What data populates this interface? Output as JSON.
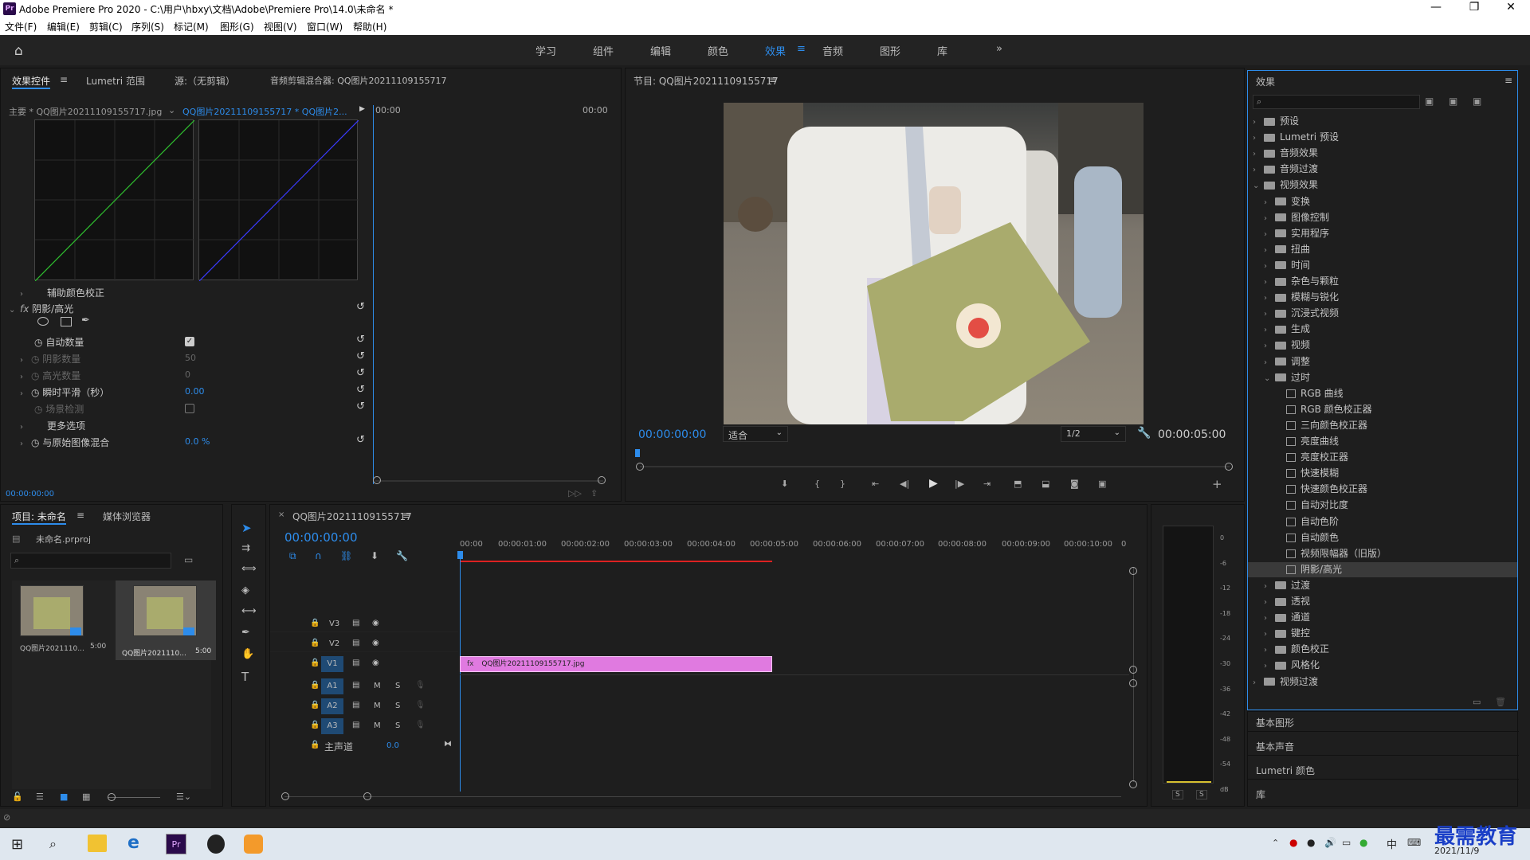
{
  "window": {
    "title": "Adobe Premiere Pro 2020 - C:\\用户\\hbxy\\文档\\Adobe\\Premiere Pro\\14.0\\未命名 *",
    "logo": "Pr"
  },
  "menu": [
    "文件(F)",
    "编辑(E)",
    "剪辑(C)",
    "序列(S)",
    "标记(M)",
    "图形(G)",
    "视图(V)",
    "窗口(W)",
    "帮助(H)"
  ],
  "workspaces": [
    "学习",
    "组件",
    "编辑",
    "颜色",
    "效果",
    "音频",
    "图形",
    "库"
  ],
  "workspace_active": "效果",
  "effect_controls": {
    "tabs": [
      "效果控件",
      "Lumetri 范围",
      "源:（无剪辑）",
      "音频剪辑混合器: QQ图片20211109155717"
    ],
    "master": "主要 * QQ图片20211109155717.jpg",
    "clip": "QQ图片20211109155717 * QQ图片2...",
    "time_start": "00:00",
    "time_end": "00:00",
    "sections": [
      {
        "label": "辅助颜色校正"
      },
      {
        "label": "阴影/高光"
      }
    ],
    "params": [
      {
        "label": "自动数量",
        "value": ""
      },
      {
        "label": "阴影数量",
        "value": "50"
      },
      {
        "label": "高光数量",
        "value": "0"
      },
      {
        "label": "瞬时平滑（秒）",
        "value": "0.00"
      },
      {
        "label": "场景检测",
        "value": ""
      },
      {
        "label": "更多选项",
        "value": ""
      },
      {
        "label": "与原始图像混合",
        "value": "0.0 %"
      }
    ],
    "timecode": "00:00:00:00"
  },
  "program": {
    "title": "节目: QQ图片20211109155717",
    "timecode": "00:00:00:00",
    "fit": "适合",
    "quality": "1/2",
    "duration": "00:00:05:00"
  },
  "project": {
    "tabs": [
      "项目: 未命名",
      "媒体浏览器"
    ],
    "file": "未命名.prproj",
    "items": [
      {
        "name": "QQ图片2021110...",
        "dur": "5:00"
      },
      {
        "name": "QQ图片2021110...",
        "dur": "5:00"
      }
    ]
  },
  "timeline": {
    "title": "QQ图片20211109155717",
    "timecode": "00:00:00:00",
    "ruler": [
      "00:00",
      "00:00:01:00",
      "00:00:02:00",
      "00:00:03:00",
      "00:00:04:00",
      "00:00:05:00",
      "00:00:06:00",
      "00:00:07:00",
      "00:00:08:00",
      "00:00:09:00",
      "00:00:10:00",
      "0"
    ],
    "video_tracks": [
      "V3",
      "V2",
      "V1"
    ],
    "audio_tracks": [
      "A1",
      "A2",
      "A3"
    ],
    "master": "主声道",
    "master_value": "0.0",
    "clip": "QQ图片20211109155717.jpg"
  },
  "meter": {
    "scale": [
      "0",
      "-6",
      "-12",
      "-18",
      "-24",
      "-30",
      "-36",
      "-42",
      "-48",
      "-54",
      "dB"
    ],
    "solo": [
      "S",
      "S"
    ]
  },
  "effects_panel": {
    "title": "效果",
    "tree": [
      {
        "label": "预设",
        "level": 0,
        "type": "folder"
      },
      {
        "label": "Lumetri 预设",
        "level": 0,
        "type": "folder"
      },
      {
        "label": "音频效果",
        "level": 0,
        "type": "folder"
      },
      {
        "label": "音频过渡",
        "level": 0,
        "type": "folder"
      },
      {
        "label": "视频效果",
        "level": 0,
        "type": "folder",
        "open": true
      },
      {
        "label": "变换",
        "level": 1,
        "type": "folder"
      },
      {
        "label": "图像控制",
        "level": 1,
        "type": "folder"
      },
      {
        "label": "实用程序",
        "level": 1,
        "type": "folder"
      },
      {
        "label": "扭曲",
        "level": 1,
        "type": "folder"
      },
      {
        "label": "时间",
        "level": 1,
        "type": "folder"
      },
      {
        "label": "杂色与颗粒",
        "level": 1,
        "type": "folder"
      },
      {
        "label": "模糊与锐化",
        "level": 1,
        "type": "folder"
      },
      {
        "label": "沉浸式视频",
        "level": 1,
        "type": "folder"
      },
      {
        "label": "生成",
        "level": 1,
        "type": "folder"
      },
      {
        "label": "视频",
        "level": 1,
        "type": "folder"
      },
      {
        "label": "调整",
        "level": 1,
        "type": "folder"
      },
      {
        "label": "过时",
        "level": 1,
        "type": "folder",
        "open": true
      },
      {
        "label": "RGB 曲线",
        "level": 2,
        "type": "fx"
      },
      {
        "label": "RGB 颜色校正器",
        "level": 2,
        "type": "fx"
      },
      {
        "label": "三向颜色校正器",
        "level": 2,
        "type": "fx"
      },
      {
        "label": "亮度曲线",
        "level": 2,
        "type": "fx"
      },
      {
        "label": "亮度校正器",
        "level": 2,
        "type": "fx"
      },
      {
        "label": "快速模糊",
        "level": 2,
        "type": "fx"
      },
      {
        "label": "快速颜色校正器",
        "level": 2,
        "type": "fx"
      },
      {
        "label": "自动对比度",
        "level": 2,
        "type": "fx"
      },
      {
        "label": "自动色阶",
        "level": 2,
        "type": "fx"
      },
      {
        "label": "自动颜色",
        "level": 2,
        "type": "fx"
      },
      {
        "label": "视频限幅器（旧版）",
        "level": 2,
        "type": "fx"
      },
      {
        "label": "阴影/高光",
        "level": 2,
        "type": "fx",
        "selected": true
      },
      {
        "label": "过渡",
        "level": 1,
        "type": "folder"
      },
      {
        "label": "透视",
        "level": 1,
        "type": "folder"
      },
      {
        "label": "通道",
        "level": 1,
        "type": "folder"
      },
      {
        "label": "键控",
        "level": 1,
        "type": "folder"
      },
      {
        "label": "颜色校正",
        "level": 1,
        "type": "folder"
      },
      {
        "label": "风格化",
        "level": 1,
        "type": "folder"
      },
      {
        "label": "视频过渡",
        "level": 0,
        "type": "folder"
      }
    ],
    "collapsed": [
      "基本图形",
      "基本声音",
      "Lumetri 颜色",
      "库"
    ]
  },
  "taskbar": {
    "ime": "中",
    "date": "2021/11/9"
  },
  "watermark": "最需教育",
  "colors": {
    "accent": "#2d8ceb",
    "clip": "#e07ae0",
    "panel": "#1e1e1e"
  }
}
